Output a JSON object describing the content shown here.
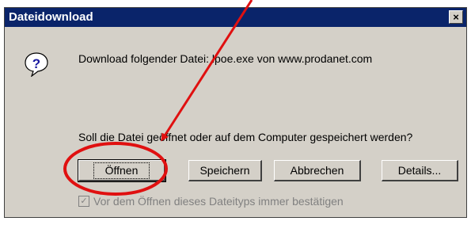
{
  "title": "Dateidownload",
  "close_label": "×",
  "message1": "Download folgender Datei: lpoe.exe von www.prodanet.com",
  "message2": "Soll die Datei geöffnet oder auf dem Computer gespeichert werden?",
  "buttons": {
    "open": "Öffnen",
    "save": "Speichern",
    "cancel": "Abbrechen",
    "details": "Details..."
  },
  "checkbox": {
    "label": "Vor dem Öffnen dieses Dateityps immer bestätigen",
    "checked": true,
    "enabled": false
  },
  "colors": {
    "titlebar": "#0a246a",
    "face": "#d4d0c8",
    "annotation": "#e01010"
  }
}
